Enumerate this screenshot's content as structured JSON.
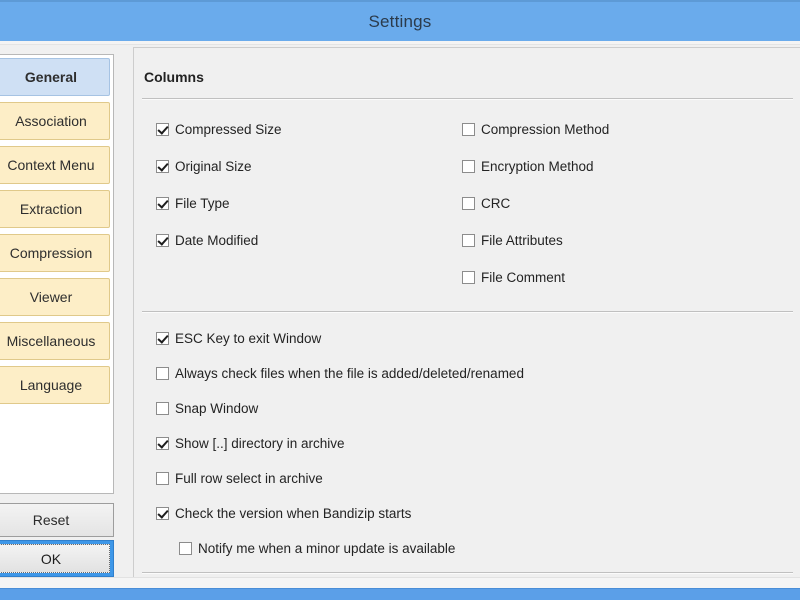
{
  "window": {
    "title": "Settings"
  },
  "sidebar": {
    "items": [
      {
        "label": "General",
        "selected": true
      },
      {
        "label": "Association",
        "selected": false
      },
      {
        "label": "Context Menu",
        "selected": false
      },
      {
        "label": "Extraction",
        "selected": false
      },
      {
        "label": "Compression",
        "selected": false
      },
      {
        "label": "Viewer",
        "selected": false
      },
      {
        "label": "Miscellaneous",
        "selected": false
      },
      {
        "label": "Language",
        "selected": false
      }
    ],
    "reset_label": "Reset",
    "ok_label": "OK"
  },
  "content": {
    "section_title": "Columns",
    "columns_left": [
      {
        "label": "Compressed Size",
        "checked": true
      },
      {
        "label": "Original Size",
        "checked": true
      },
      {
        "label": "File Type",
        "checked": true
      },
      {
        "label": "Date Modified",
        "checked": true
      }
    ],
    "columns_right": [
      {
        "label": "Compression Method",
        "checked": false
      },
      {
        "label": "Encryption Method",
        "checked": false
      },
      {
        "label": "CRC",
        "checked": false
      },
      {
        "label": "File Attributes",
        "checked": false
      },
      {
        "label": "File Comment",
        "checked": false
      }
    ],
    "options": [
      {
        "label": "ESC Key to exit Window",
        "checked": true,
        "indent": false
      },
      {
        "label": "Always check files when the file is added/deleted/renamed",
        "checked": false,
        "indent": false
      },
      {
        "label": "Snap Window",
        "checked": false,
        "indent": false
      },
      {
        "label": "Show [..] directory in archive",
        "checked": true,
        "indent": false
      },
      {
        "label": "Full row select in archive",
        "checked": false,
        "indent": false
      },
      {
        "label": "Check the version when Bandizip starts",
        "checked": true,
        "indent": false
      },
      {
        "label": "Notify me when a minor update is available",
        "checked": false,
        "indent": true
      }
    ]
  },
  "theme": {
    "titlebar_blue": "#6aabec",
    "selected_item_blue": "#cfe0f4",
    "item_cream": "#fdeec7",
    "accent_blue": "#3e97e8"
  }
}
